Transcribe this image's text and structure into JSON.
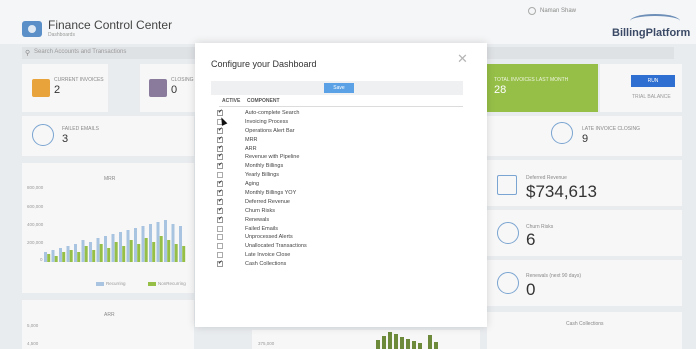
{
  "header": {
    "app_title": "Finance Control Center",
    "app_subtitle": "Dashboards",
    "user_name": "Naman Shaw",
    "brand": "BillingPlatform"
  },
  "search": {
    "placeholder": "Search Accounts and Transactions"
  },
  "kpis": {
    "current_invoices": {
      "label": "CURRENT INVOICES",
      "value": "2"
    },
    "closing": {
      "label": "CLOSING",
      "value": "0"
    },
    "failed_emails": {
      "label": "FAILED EMAILS",
      "value": "3"
    },
    "total_invoices_last_month": {
      "label": "TOTAL INVOICES LAST MONTH",
      "value": "28"
    },
    "late_invoice_closing": {
      "label": "LATE INVOICE CLOSING",
      "value": "9"
    },
    "run_label": "RUN",
    "trial_balance_label": "TRIAL BALANCE"
  },
  "metrics": {
    "deferred_revenue": {
      "label": "Deferred Revenue",
      "value": "$734,613"
    },
    "churn_risks": {
      "label": "Churn Risks",
      "value": "6"
    },
    "renewals": {
      "label": "Renewals (next 90 days)",
      "value": "0"
    },
    "cash_collections_label": "Cash Collections"
  },
  "mrr_chart": {
    "title": "MRR",
    "y_ticks": [
      "800,000",
      "600,000",
      "400,000",
      "200,000",
      "0"
    ],
    "legend": [
      "Recurring",
      "NonRecurring"
    ],
    "colors": {
      "recurring": "#a9c4e0",
      "nonrecurring": "#96bf48"
    }
  },
  "arr_chart": {
    "title": "ARR",
    "y_ticks": [
      "5,000",
      "4,500"
    ]
  },
  "lower_chart_tick": "375,000",
  "modal": {
    "title": "Configure your Dashboard",
    "save_label": "Save",
    "col_active": "ACTIVE",
    "col_component": "COMPONENT",
    "components": [
      {
        "name": "Auto-complete Search",
        "active": true
      },
      {
        "name": "Invoicing Process",
        "active": false
      },
      {
        "name": "Operations Alert Bar",
        "active": true
      },
      {
        "name": "MRR",
        "active": true
      },
      {
        "name": "ARR",
        "active": true
      },
      {
        "name": "Revenue with Pipeline",
        "active": true
      },
      {
        "name": "Monthly Billings",
        "active": true
      },
      {
        "name": "Yearly Billings",
        "active": false
      },
      {
        "name": "Aging",
        "active": true
      },
      {
        "name": "Monthly Billings YOY",
        "active": true
      },
      {
        "name": "Deferred Revenue",
        "active": true
      },
      {
        "name": "Churn Risks",
        "active": true
      },
      {
        "name": "Renewals",
        "active": true
      },
      {
        "name": "Failed Emails",
        "active": false
      },
      {
        "name": "Unprocessed Alerts",
        "active": false
      },
      {
        "name": "Unallocated Transactions",
        "active": false
      },
      {
        "name": "Late Invoice Close",
        "active": false
      },
      {
        "name": "Cash Collections",
        "active": true
      }
    ]
  }
}
